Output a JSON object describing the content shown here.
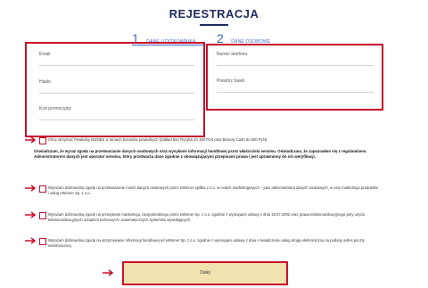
{
  "page": {
    "title": "REJESTRACJA"
  },
  "steps": [
    {
      "number": "1",
      "label": "DANE UŻYTKOWNIKA"
    },
    {
      "number": "2",
      "label": "DANE OSOBOWE"
    }
  ],
  "left_form": {
    "fields": [
      {
        "label": "Email",
        "value": ""
      },
      {
        "label": "Hasło",
        "value": ""
      },
      {
        "label": "Kod promocyjny",
        "value": ""
      }
    ]
  },
  "right_form": {
    "fields": [
      {
        "label": "Numer telefonu",
        "value": ""
      },
      {
        "label": "Powtórz hasło",
        "value": ""
      }
    ]
  },
  "consents": {
    "first": "Chcę otrzymać Powitalny BIZNES w ramach bonusów powitalnych (Zakład Bez Ryzyka do 150 PLN oraz Bonusy Cash do 500 PLN).",
    "declaration": "Oświadczam, że wyraz zgodę na przetwarzanie danych osobowych oraz wysyłanie informacji handlowej przez właściciela serwisu. Oświadczam, że zapoznałem się z regulaminem. Administratorem danych jest operator serwisu, który przetwarza dane zgodnie z obowiązującymi przepisami prawa i jest uprawniony do ich weryfikacji.",
    "items": [
      "Wyrażam dobrowolną zgodę na przetwarzanie moich danych osobowych przez eWinner spółka z o.o. w celach marketingowych – jako administratora danych osobowych, w celu marketingu produktów i usług eWinner Sp. z o.o.",
      "Wyrażam dobrowolną zgodę na przesyłanie marketingu, bezpośredniego przez eWinner Sp. z o.o. zgodnie z wymogami ustawy z dnia 18.07.2002 oraz prawa telekomunikacyjnego przy użyciu telekomunikacyjnych urządzeń końcowych i automatycznych systemów wywołujących.",
      "Wyrażam dobrowolną zgodę na otrzymywanie informacji handlowej od eWinner Sp. z o.o. zgodnie z wymogami ustawy z dnia o świadczeniu usług drogą elektroniczną na podany adres poczty elektronicznej."
    ]
  },
  "submit": {
    "label": "Dalej"
  },
  "colors": {
    "highlight": "#c8102e",
    "title": "#1f2b5c",
    "step": "#3b63c9",
    "button_bg": "#f2e2b0"
  }
}
